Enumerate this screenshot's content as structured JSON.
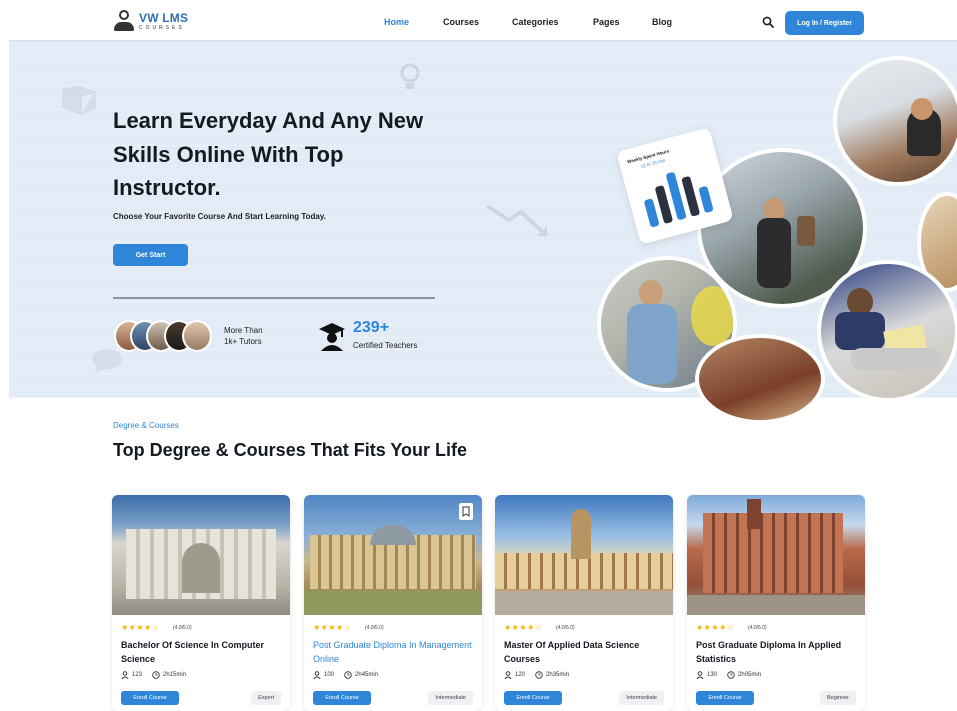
{
  "brand": {
    "name": "VW LMS",
    "tagline": "COURSES",
    "accent": "#2f86d8"
  },
  "nav": {
    "items": [
      {
        "label": "Home",
        "active": true
      },
      {
        "label": "Courses",
        "active": false
      },
      {
        "label": "Categories",
        "active": false
      },
      {
        "label": "Pages",
        "active": false
      },
      {
        "label": "Blog",
        "active": false
      }
    ],
    "search_icon": "search-icon",
    "login_label": "Log In / Register"
  },
  "hero": {
    "headline": "Learn Everyday And Any New Skills Online With Top Instructor.",
    "subline": "Choose Your Favorite Course And Start Learning Today.",
    "cta_label": "Get Start",
    "tutors_text_1": "More Than",
    "tutors_text_2": "1k+ Tutors",
    "teachers_count": "239+",
    "teachers_label": "Certified Teachers",
    "chart_card": {
      "title": "Weekly Spent Hours",
      "subtitle": "12 hr 15 min"
    }
  },
  "section": {
    "kicker": "Degree & Courses",
    "title": "Top Degree & Courses That Fits Your Life"
  },
  "courses": [
    {
      "title": "Bachelor Of Science In Computer Science",
      "stars": "★★★★☆",
      "rating": "(4.0/5.0)",
      "students": "123",
      "duration": "2h15min",
      "enroll_label": "Enroll Course",
      "level": "Expert",
      "highlight": false
    },
    {
      "title": "Post Graduate Diploma In Management Online",
      "stars": "★★★★☆",
      "rating": "(4.0/5.0)",
      "students": "100",
      "duration": "2h45min",
      "enroll_label": "Enroll Course",
      "level": "Intermediate",
      "highlight": true
    },
    {
      "title": "Master Of Applied Data Science Courses",
      "stars": "★★★★☆",
      "rating": "(4.0/5.0)",
      "students": "120",
      "duration": "2h35min",
      "enroll_label": "Enroll Course",
      "level": "Intermediate",
      "highlight": false
    },
    {
      "title": "Post Graduate Diploma In Applied Statistics",
      "stars": "★★★★☆",
      "rating": "(4.0/5.0)",
      "students": "130",
      "duration": "2h05min",
      "enroll_label": "Enroll Course",
      "level": "Beginner",
      "highlight": false
    }
  ]
}
